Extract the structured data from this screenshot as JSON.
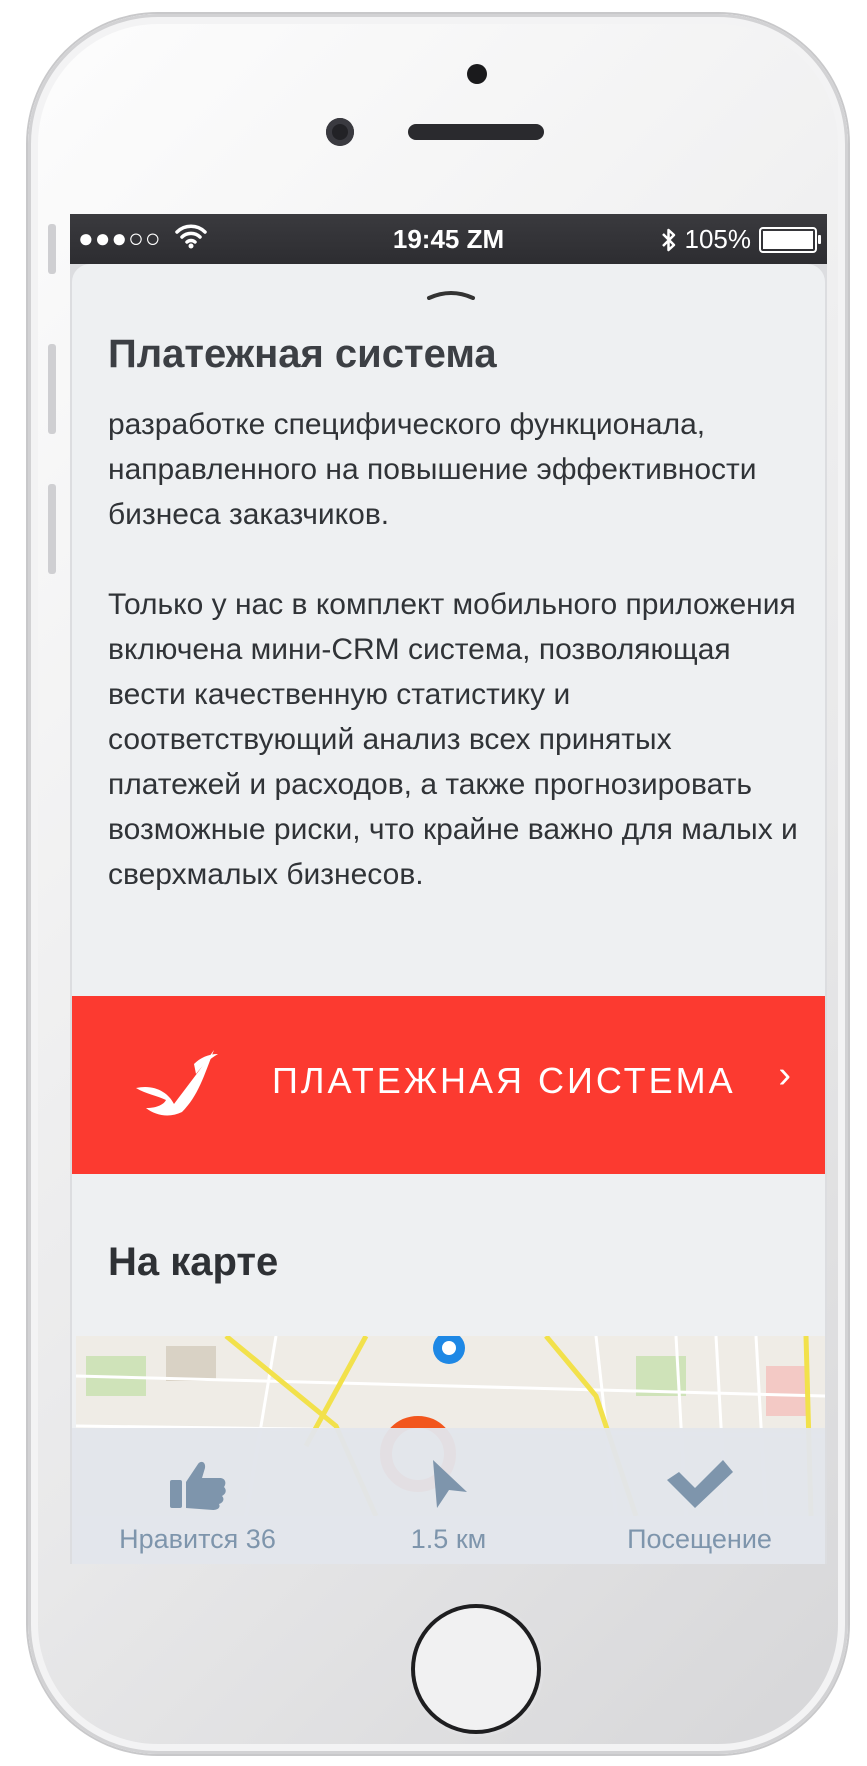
{
  "status_bar": {
    "signal": "●●●○○",
    "time": "19:45 ZM",
    "bluetooth_icon": "bluetooth-icon",
    "battery": "105%"
  },
  "content": {
    "title": "Платежная система",
    "paragraph1": "разработке специфического функционала, направленного на повышение эффективности бизнеса заказчиков.",
    "paragraph2": "Только у нас в комплект мобильного приложения включена мини-CRM система, позволяющая вести качественную статистику и соответствующий анализ всех принятых платежей и расходов, а также прогнозировать возможные риски, что крайне важно для малых и сверхмалых бизнесов."
  },
  "red_button": {
    "label": "ПЛАТЕЖНАЯ СИСТЕМА",
    "chevron": "›",
    "icon": "bird-logo-icon",
    "color": "#fc3a30"
  },
  "map_section": {
    "title": "На карте"
  },
  "tab_bar": {
    "items": [
      {
        "icon": "thumbs-up-icon",
        "label": "Нравится 36"
      },
      {
        "icon": "navigation-arrow-icon",
        "label": "1.5 км"
      },
      {
        "icon": "checkmark-icon",
        "label": "Посещение"
      }
    ],
    "label_color": "#7e95ac"
  }
}
